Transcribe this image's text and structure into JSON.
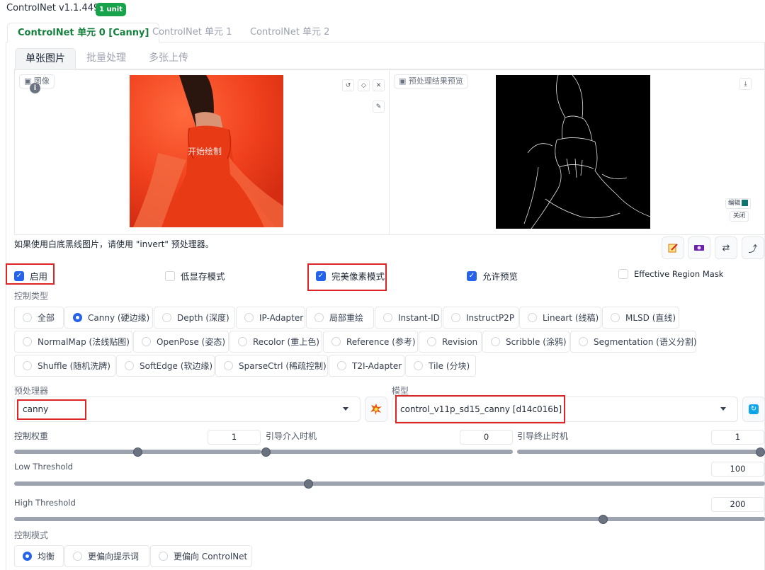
{
  "header": {
    "title": "ControlNet v1.1.449",
    "badge": "1 unit"
  },
  "unit_tabs": [
    "ControlNet 单元 0 [Canny]",
    "ControlNet 单元 1",
    "ControlNet 单元 2"
  ],
  "mode_tabs": [
    "单张图片",
    "批量处理",
    "多张上传"
  ],
  "image_panel": {
    "label": "图像",
    "overlay_text": "开始绘制"
  },
  "preview_panel": {
    "label": "预处理结果预览",
    "edit_label": "编辑",
    "close_label": "关闭"
  },
  "note": "如果使用白底黑线图片，请使用 \"invert\" 预处理器。",
  "options": [
    {
      "label": "启用",
      "checked": true
    },
    {
      "label": "低显存模式",
      "checked": false
    },
    {
      "label": "完美像素模式",
      "checked": true
    },
    {
      "label": "允许预览",
      "checked": true
    },
    {
      "label": "Effective Region Mask",
      "checked": false
    }
  ],
  "control_type": {
    "label": "控制类型",
    "selected": "Canny (硬边缘)",
    "options": [
      "全部",
      "Canny (硬边缘)",
      "Depth (深度)",
      "IP-Adapter",
      "局部重绘",
      "Instant-ID",
      "InstructP2P",
      "Lineart (线稿)",
      "MLSD (直线)",
      "NormalMap (法线贴图)",
      "OpenPose (姿态)",
      "Recolor (重上色)",
      "Reference (参考)",
      "Revision",
      "Scribble (涂鸦)",
      "Segmentation (语义分割)",
      "Shuffle (随机洗牌)",
      "SoftEdge (软边缘)",
      "SparseCtrl (稀疏控制)",
      "T2I-Adapter",
      "Tile (分块)"
    ]
  },
  "preprocessor": {
    "label": "预处理器",
    "value": "canny"
  },
  "model": {
    "label": "模型",
    "value": "control_v11p_sd15_canny [d14c016b]"
  },
  "sliders": {
    "weight": {
      "label": "控制权重",
      "value": "1",
      "fraction": 0.5
    },
    "start": {
      "label": "引导介入时机",
      "value": "0",
      "fraction": 0
    },
    "end": {
      "label": "引导终止时机",
      "value": "1",
      "fraction": 1
    },
    "low": {
      "label": "Low Threshold",
      "value": "100",
      "fraction": 0.392
    },
    "high": {
      "label": "High Threshold",
      "value": "200",
      "fraction": 0.784
    }
  },
  "control_mode": {
    "label": "控制模式",
    "selected": "均衡",
    "options": [
      "均衡",
      "更偏向提示词",
      "更偏向 ControlNet"
    ]
  },
  "colors": {
    "accent": "#2563eb",
    "badge": "#16a34a",
    "highlight": "#dc2626",
    "active_tab": "#15803d"
  }
}
